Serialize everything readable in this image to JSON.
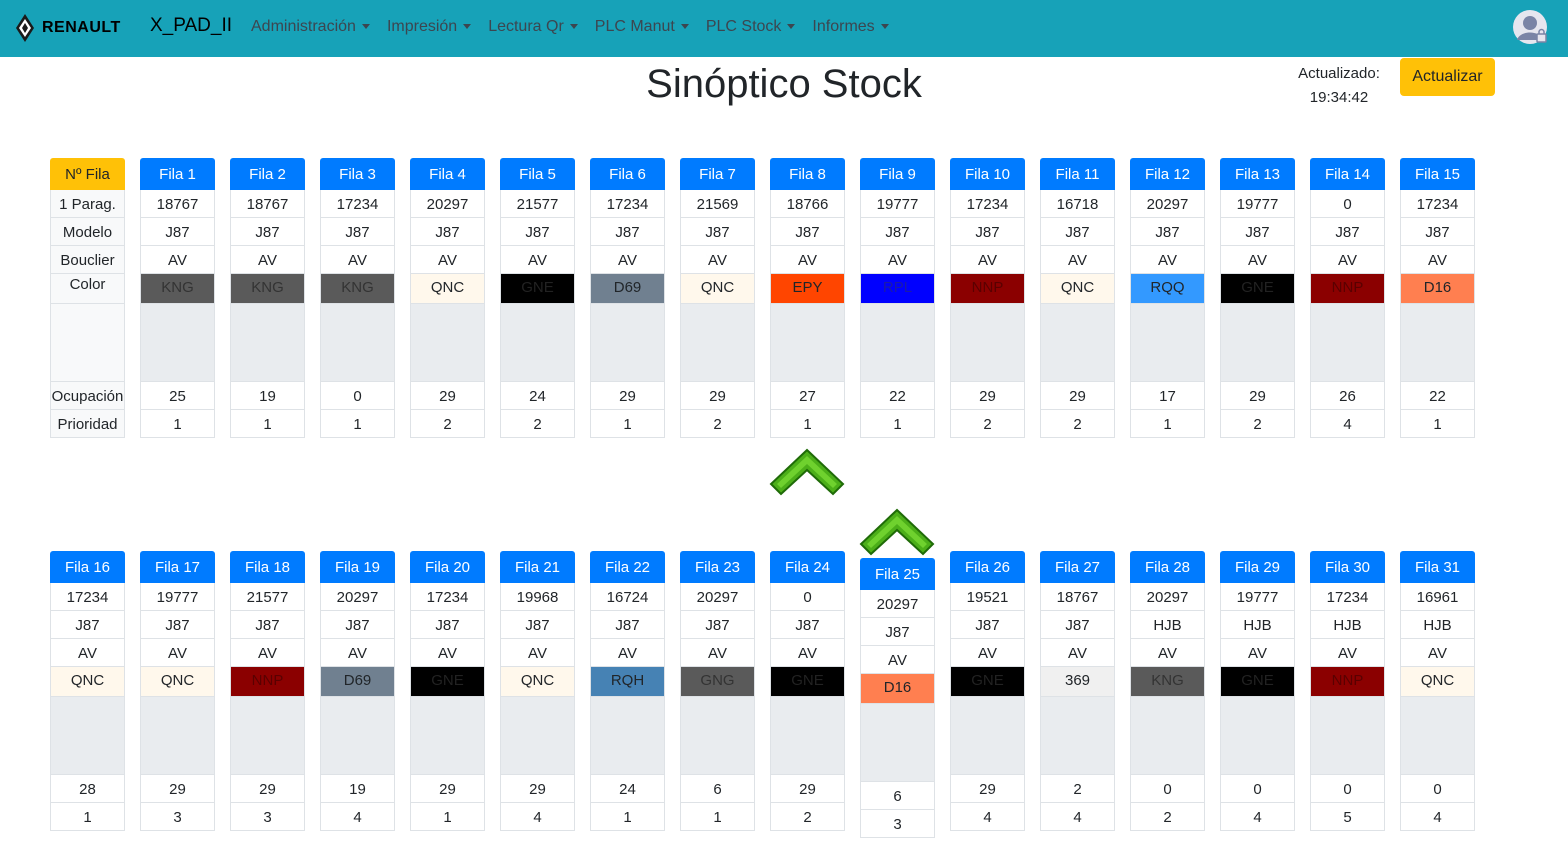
{
  "navbar": {
    "brand": "RENAULT",
    "app_title": "X_PAD_II",
    "menu": [
      "Administración",
      "Impresión",
      "Lectura Qr",
      "PLC Manut",
      "PLC Stock",
      "Informes"
    ]
  },
  "page": {
    "title": "Sinóptico Stock",
    "updated_label": "Actualizado:",
    "updated_time": "19:34:42",
    "refresh_label": "Actualizar"
  },
  "labels": {
    "header": "Nº Fila",
    "parag": "1 Parag.",
    "modelo": "Modelo",
    "bouclier": "Bouclier",
    "color": "Color",
    "ocupacion": "Ocupación",
    "prioridad": "Prioridad"
  },
  "rows_top": [
    {
      "name": "Fila 1",
      "parag": "18767",
      "modelo": "J87",
      "bouclier": "AV",
      "color": "KNG",
      "bg": "#5a5a5a",
      "fg": "#333333",
      "ocupacion": "25",
      "prioridad": "1"
    },
    {
      "name": "Fila 2",
      "parag": "18767",
      "modelo": "J87",
      "bouclier": "AV",
      "color": "KNG",
      "bg": "#5a5a5a",
      "fg": "#333333",
      "ocupacion": "19",
      "prioridad": "1"
    },
    {
      "name": "Fila 3",
      "parag": "17234",
      "modelo": "J87",
      "bouclier": "AV",
      "color": "KNG",
      "bg": "#5a5a5a",
      "fg": "#333333",
      "ocupacion": "0",
      "prioridad": "1"
    },
    {
      "name": "Fila 4",
      "parag": "20297",
      "modelo": "J87",
      "bouclier": "AV",
      "color": "QNC",
      "bg": "#fff8ec",
      "fg": "#212529",
      "ocupacion": "29",
      "prioridad": "2"
    },
    {
      "name": "Fila 5",
      "parag": "21577",
      "modelo": "J87",
      "bouclier": "AV",
      "color": "GNE",
      "bg": "#000000",
      "fg": "#222222",
      "ocupacion": "24",
      "prioridad": "2"
    },
    {
      "name": "Fila 6",
      "parag": "17234",
      "modelo": "J87",
      "bouclier": "AV",
      "color": "D69",
      "bg": "#708090",
      "fg": "#212529",
      "ocupacion": "29",
      "prioridad": "1"
    },
    {
      "name": "Fila 7",
      "parag": "21569",
      "modelo": "J87",
      "bouclier": "AV",
      "color": "QNC",
      "bg": "#fff8ec",
      "fg": "#212529",
      "ocupacion": "29",
      "prioridad": "2"
    },
    {
      "name": "Fila 8",
      "parag": "18766",
      "modelo": "J87",
      "bouclier": "AV",
      "color": "EPY",
      "bg": "#ff4500",
      "fg": "#212529",
      "ocupacion": "27",
      "prioridad": "1"
    },
    {
      "name": "Fila 9",
      "parag": "19777",
      "modelo": "J87",
      "bouclier": "AV",
      "color": "RPL",
      "bg": "#0000ff",
      "fg": "#1a1aaa",
      "ocupacion": "22",
      "prioridad": "1"
    },
    {
      "name": "Fila 10",
      "parag": "17234",
      "modelo": "J87",
      "bouclier": "AV",
      "color": "NNP",
      "bg": "#8b0000",
      "fg": "#5a0000",
      "ocupacion": "29",
      "prioridad": "2"
    },
    {
      "name": "Fila 11",
      "parag": "16718",
      "modelo": "J87",
      "bouclier": "AV",
      "color": "QNC",
      "bg": "#fff8ec",
      "fg": "#212529",
      "ocupacion": "29",
      "prioridad": "2"
    },
    {
      "name": "Fila 12",
      "parag": "20297",
      "modelo": "J87",
      "bouclier": "AV",
      "color": "RQQ",
      "bg": "#3399ff",
      "fg": "#212529",
      "ocupacion": "17",
      "prioridad": "1"
    },
    {
      "name": "Fila 13",
      "parag": "19777",
      "modelo": "J87",
      "bouclier": "AV",
      "color": "GNE",
      "bg": "#000000",
      "fg": "#222222",
      "ocupacion": "29",
      "prioridad": "2"
    },
    {
      "name": "Fila 14",
      "parag": "0",
      "modelo": "J87",
      "bouclier": "AV",
      "color": "NNP",
      "bg": "#8b0000",
      "fg": "#5a0000",
      "ocupacion": "26",
      "prioridad": "4"
    },
    {
      "name": "Fila 15",
      "parag": "17234",
      "modelo": "J87",
      "bouclier": "AV",
      "color": "D16",
      "bg": "#ff7f50",
      "fg": "#212529",
      "ocupacion": "22",
      "prioridad": "1"
    }
  ],
  "rows_bottom": [
    {
      "name": "Fila 16",
      "parag": "17234",
      "modelo": "J87",
      "bouclier": "AV",
      "color": "QNC",
      "bg": "#fff8ec",
      "fg": "#212529",
      "ocupacion": "28",
      "prioridad": "1"
    },
    {
      "name": "Fila 17",
      "parag": "19777",
      "modelo": "J87",
      "bouclier": "AV",
      "color": "QNC",
      "bg": "#fff8ec",
      "fg": "#212529",
      "ocupacion": "29",
      "prioridad": "3"
    },
    {
      "name": "Fila 18",
      "parag": "21577",
      "modelo": "J87",
      "bouclier": "AV",
      "color": "NNP",
      "bg": "#8b0000",
      "fg": "#5a0000",
      "ocupacion": "29",
      "prioridad": "3"
    },
    {
      "name": "Fila 19",
      "parag": "20297",
      "modelo": "J87",
      "bouclier": "AV",
      "color": "D69",
      "bg": "#708090",
      "fg": "#212529",
      "ocupacion": "19",
      "prioridad": "4"
    },
    {
      "name": "Fila 20",
      "parag": "17234",
      "modelo": "J87",
      "bouclier": "AV",
      "color": "GNE",
      "bg": "#000000",
      "fg": "#222222",
      "ocupacion": "29",
      "prioridad": "1"
    },
    {
      "name": "Fila 21",
      "parag": "19968",
      "modelo": "J87",
      "bouclier": "AV",
      "color": "QNC",
      "bg": "#fff8ec",
      "fg": "#212529",
      "ocupacion": "29",
      "prioridad": "4"
    },
    {
      "name": "Fila 22",
      "parag": "16724",
      "modelo": "J87",
      "bouclier": "AV",
      "color": "RQH",
      "bg": "#4682b4",
      "fg": "#212529",
      "ocupacion": "24",
      "prioridad": "1"
    },
    {
      "name": "Fila 23",
      "parag": "20297",
      "modelo": "J87",
      "bouclier": "AV",
      "color": "GNG",
      "bg": "#5a5a5a",
      "fg": "#333333",
      "ocupacion": "6",
      "prioridad": "1"
    },
    {
      "name": "Fila 24",
      "parag": "0",
      "modelo": "J87",
      "bouclier": "AV",
      "color": "GNE",
      "bg": "#000000",
      "fg": "#222222",
      "ocupacion": "29",
      "prioridad": "2"
    },
    {
      "name": "Fila 25",
      "parag": "20297",
      "modelo": "J87",
      "bouclier": "AV",
      "color": "D16",
      "bg": "#ff7f50",
      "fg": "#212529",
      "ocupacion": "6",
      "prioridad": "3"
    },
    {
      "name": "Fila 26",
      "parag": "19521",
      "modelo": "J87",
      "bouclier": "AV",
      "color": "GNE",
      "bg": "#000000",
      "fg": "#222222",
      "ocupacion": "29",
      "prioridad": "4"
    },
    {
      "name": "Fila 27",
      "parag": "18767",
      "modelo": "J87",
      "bouclier": "AV",
      "color": "369",
      "bg": "#f0f0f0",
      "fg": "#212529",
      "ocupacion": "2",
      "prioridad": "4"
    },
    {
      "name": "Fila 28",
      "parag": "20297",
      "modelo": "HJB",
      "bouclier": "AV",
      "color": "KNG",
      "bg": "#5a5a5a",
      "fg": "#333333",
      "ocupacion": "0",
      "prioridad": "2"
    },
    {
      "name": "Fila 29",
      "parag": "19777",
      "modelo": "HJB",
      "bouclier": "AV",
      "color": "GNE",
      "bg": "#000000",
      "fg": "#222222",
      "ocupacion": "0",
      "prioridad": "4"
    },
    {
      "name": "Fila 30",
      "parag": "17234",
      "modelo": "HJB",
      "bouclier": "AV",
      "color": "NNP",
      "bg": "#8b0000",
      "fg": "#5a0000",
      "ocupacion": "0",
      "prioridad": "5"
    },
    {
      "name": "Fila 31",
      "parag": "16961",
      "modelo": "HJB",
      "bouclier": "AV",
      "color": "QNC",
      "bg": "#fff8ec",
      "fg": "#212529",
      "ocupacion": "0",
      "prioridad": "4"
    }
  ],
  "colors": {
    "navbar": "#17a2b8",
    "header_blue": "#007bff",
    "button_yellow": "#ffc107",
    "arrow_green": "#4caf19"
  },
  "icons": {
    "brand": "renault-logo-icon",
    "user": "user-lock-icon",
    "arrow": "chevron-up-arrow-icon"
  }
}
